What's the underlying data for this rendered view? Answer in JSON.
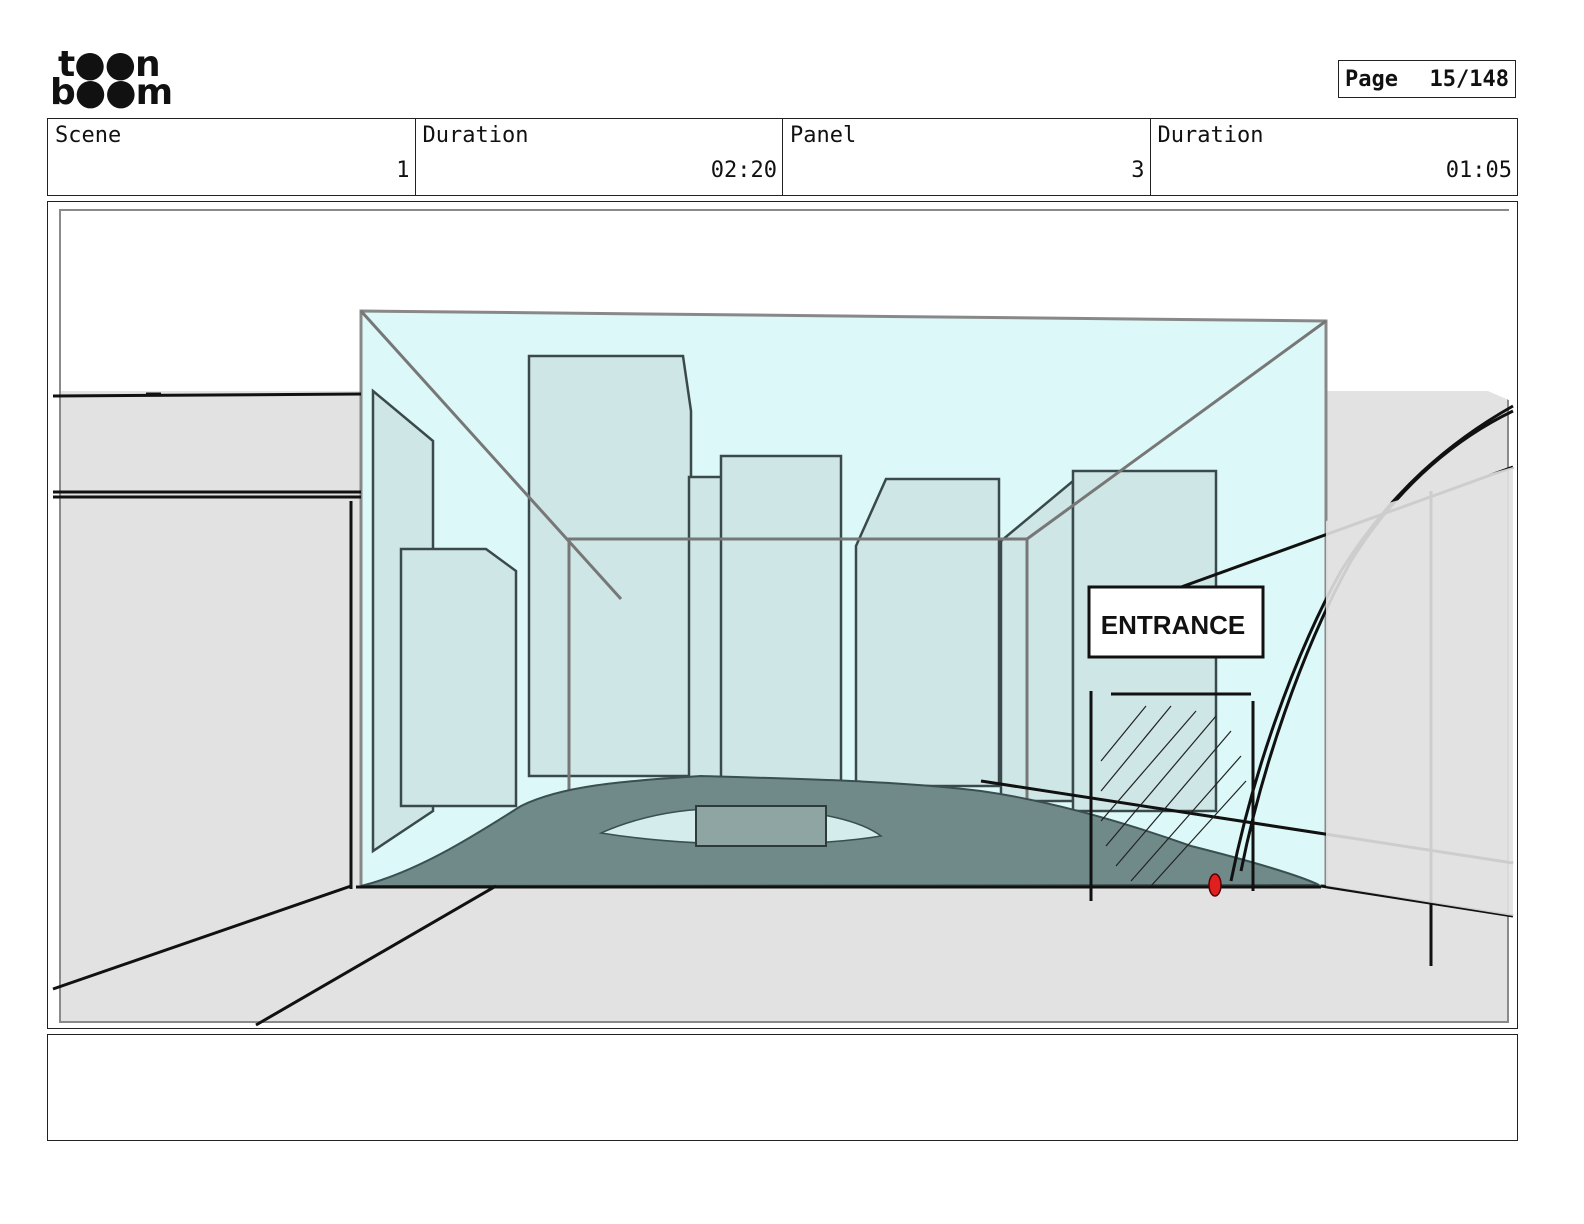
{
  "logo": {
    "line1": "t●●n",
    "line2": "b●●m"
  },
  "page": {
    "label": "Page",
    "number": "15/148"
  },
  "info": {
    "scene_label": "Scene",
    "scene_value": "1",
    "scene_duration_label": "Duration",
    "scene_duration_value": "02:20",
    "panel_label": "Panel",
    "panel_value": "3",
    "panel_duration_label": "Duration",
    "panel_duration_value": "01:05"
  },
  "drawing": {
    "sign_text": "ENTRANCE"
  },
  "notes": {
    "text": ""
  }
}
